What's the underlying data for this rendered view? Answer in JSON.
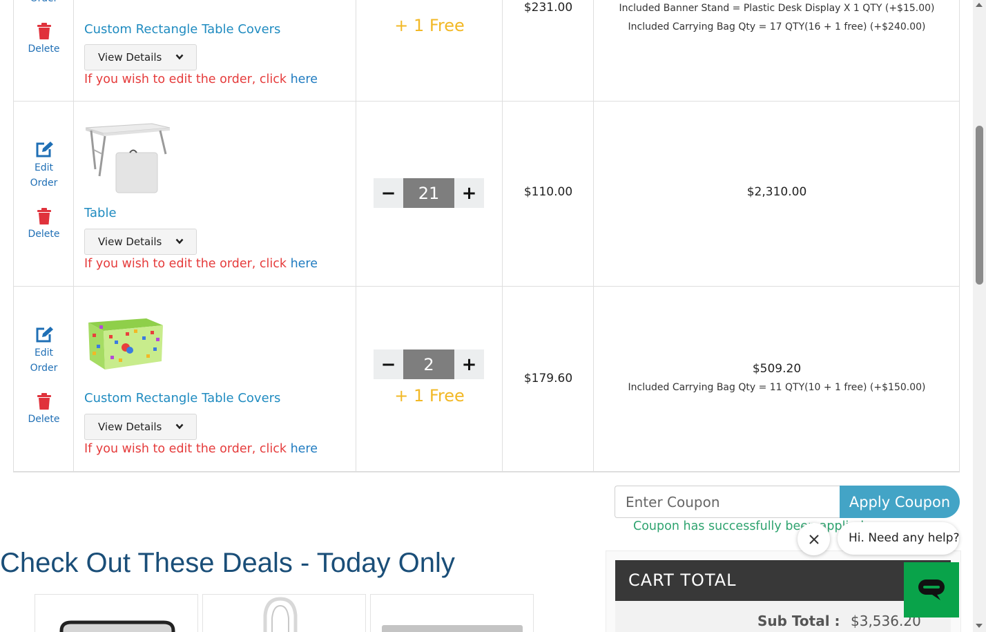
{
  "cart": {
    "actions": {
      "edit_line1": "Edit",
      "edit_line2": "Order",
      "delete": "Delete"
    },
    "view_details": "View Details",
    "edit_note_prefix": "If you wish to edit the order, click ",
    "edit_note_link": "here",
    "items": [
      {
        "name": "Custom Rectangle Table Covers",
        "free": "+ 1 Free",
        "price": "$231.00",
        "notes": [
          "Included Banner Stand = Plastic Desk Display X 1 QTY (+$15.00)",
          "Included Carrying Bag Qty = 17 QTY(16 + 1 free) (+$240.00)"
        ]
      },
      {
        "name": "Table",
        "qty": "21",
        "price": "$110.00",
        "total": "$2,310.00"
      },
      {
        "name": "Custom Rectangle Table Covers",
        "qty": "2",
        "free": "+ 1 Free",
        "price": "$179.60",
        "total": "$509.20",
        "notes": [
          "Included Carrying Bag Qty = 11 QTY(10 + 1 free) (+$150.00)"
        ]
      }
    ]
  },
  "coupon": {
    "placeholder": "Enter Coupon",
    "button": "Apply Coupon",
    "message": "Coupon has successfully been applied."
  },
  "deals": {
    "title": "Check Out These Deals - Today Only"
  },
  "cart_total": {
    "title": "CART  TOTAL",
    "subtotal_label": "Sub Total :",
    "subtotal_value": "$3,536.20"
  },
  "chat": {
    "greeting": "Hi. Need any help?"
  },
  "colors": {
    "link": "#1f8bc0",
    "warning": "#e53b3b",
    "free": "#f2b826",
    "accent": "#43a4c6",
    "success": "#2ea36f",
    "chat": "#09a34a"
  }
}
